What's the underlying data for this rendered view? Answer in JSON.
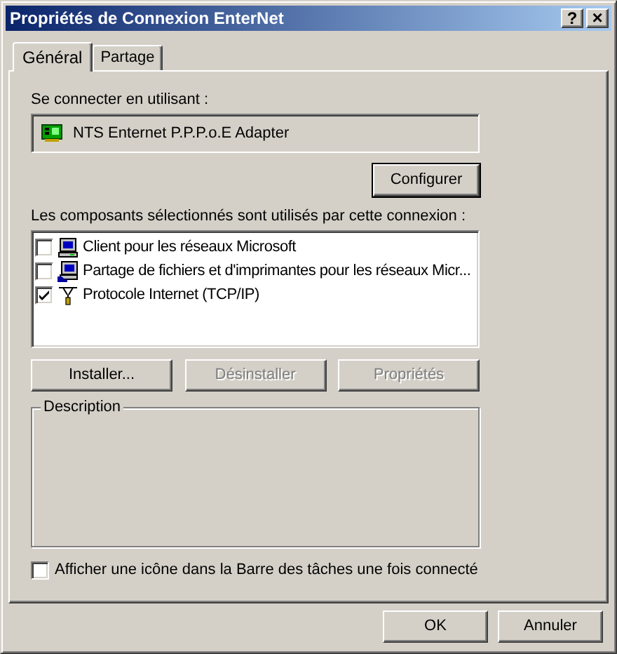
{
  "window": {
    "title": "Propriétés de Connexion EnterNet",
    "buttons": [
      {
        "label": "?",
        "kind": "help"
      },
      {
        "label": "×",
        "kind": "close"
      }
    ]
  },
  "tabs": [
    {
      "label": "Général",
      "selected": true
    },
    {
      "label": "Partage",
      "selected": false
    }
  ],
  "connect_using": {
    "label": "Se connecter en utilisant :",
    "adapter": "NTS Enternet P.P.P.o.E Adapter"
  },
  "configure_button": "Configurer",
  "components": {
    "label": "Les composants sélectionnés sont utilisés par cette connexion :",
    "items": [
      {
        "label": "Client pour les réseaux Microsoft",
        "checked": false,
        "kind": "client"
      },
      {
        "label": "Partage de fichiers et d'imprimantes pour les réseaux Micr...",
        "checked": false,
        "kind": "service"
      },
      {
        "label": "Protocole Internet (TCP/IP)",
        "checked": true,
        "kind": "protocol"
      }
    ]
  },
  "component_buttons": [
    {
      "label": "Installer...",
      "disabled": false
    },
    {
      "label": "Désinstaller",
      "disabled": true
    },
    {
      "label": "Propriétés",
      "disabled": true
    }
  ],
  "description": {
    "label": "Description"
  },
  "taskbar_option": {
    "label": "Afficher une icône dans la Barre des tâches une fois connecté",
    "checked": false
  },
  "buttons": [
    "OK",
    "Annuler"
  ]
}
